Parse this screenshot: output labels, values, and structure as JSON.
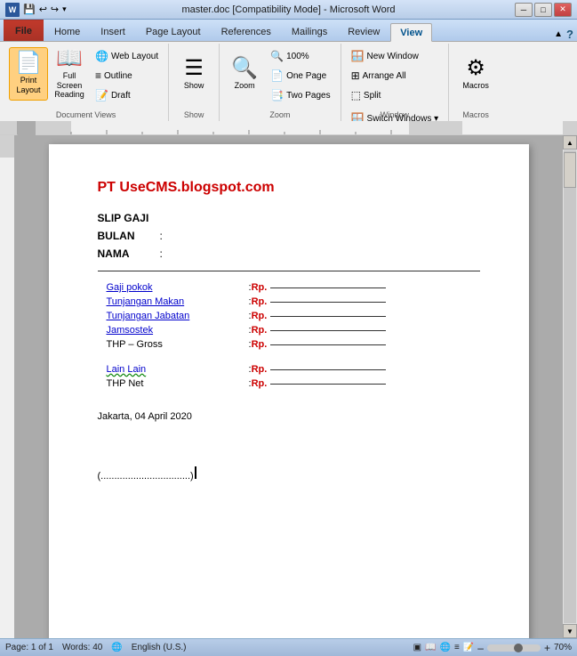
{
  "titlebar": {
    "title": "master.doc [Compatibility Mode] - Microsoft Word",
    "min": "─",
    "max": "□",
    "close": "✕"
  },
  "ribbon": {
    "tabs": [
      "File",
      "Home",
      "Insert",
      "Page Layout",
      "References",
      "Mailings",
      "Review",
      "View"
    ],
    "active_tab": "View",
    "groups": {
      "document_views": {
        "label": "Document Views",
        "buttons": [
          "Print Layout",
          "Full Screen Reading",
          "Web Layout",
          "Outline",
          "Draft"
        ]
      },
      "show": {
        "label": "Show",
        "btn": "Show"
      },
      "zoom": {
        "label": "Zoom",
        "btn": "Zoom",
        "percent": "100%"
      },
      "window": {
        "label": "Window",
        "buttons": [
          "New Window",
          "Arrange All",
          "Split",
          "Switch Windows ▾"
        ]
      },
      "macros": {
        "label": "Macros",
        "btn": "Macros"
      }
    }
  },
  "document": {
    "title": "PT UseCMS.blogspot.com",
    "fields": [
      {
        "label": "SLIP GAJI",
        "colon": false,
        "value": ""
      },
      {
        "label": "BULAN",
        "colon": true,
        "value": ""
      },
      {
        "label": "NAMA",
        "colon": true,
        "value": ""
      }
    ],
    "salary_items": [
      {
        "label": "Gaji pokok",
        "colon": ":",
        "rp": "Rp.",
        "underline": true,
        "link": true,
        "squiggly": false
      },
      {
        "label": "Tunjangan Makan",
        "colon": ":",
        "rp": "Rp.",
        "underline": true,
        "link": true,
        "squiggly": false
      },
      {
        "label": "Tunjangan Jabatan",
        "colon": ":",
        "rp": "Rp.",
        "underline": true,
        "link": true,
        "squiggly": false
      },
      {
        "label": "Jamsostek",
        "colon": ":",
        "rp": "Rp.",
        "underline": true,
        "link": true,
        "squiggly": false
      },
      {
        "label": "THP – Gross",
        "colon": ":",
        "rp": "Rp.",
        "underline": true,
        "link": false,
        "squiggly": false
      },
      {
        "label": "",
        "colon": "",
        "rp": "",
        "underline": false,
        "link": false,
        "squiggly": false
      },
      {
        "label": "Lain Lain",
        "colon": ":",
        "rp": "Rp.",
        "underline": true,
        "link": true,
        "squiggly": true
      },
      {
        "label": "THP Net",
        "colon": ":",
        "rp": "Rp.",
        "underline": true,
        "link": false,
        "squiggly": false
      }
    ],
    "date": "Jakarta, 04 April 2020",
    "signature": "(.................................)"
  },
  "statusbar": {
    "page": "Page: 1 of 1",
    "words": "Words: 40",
    "lang": "English (U.S.)",
    "zoom": "70%"
  }
}
